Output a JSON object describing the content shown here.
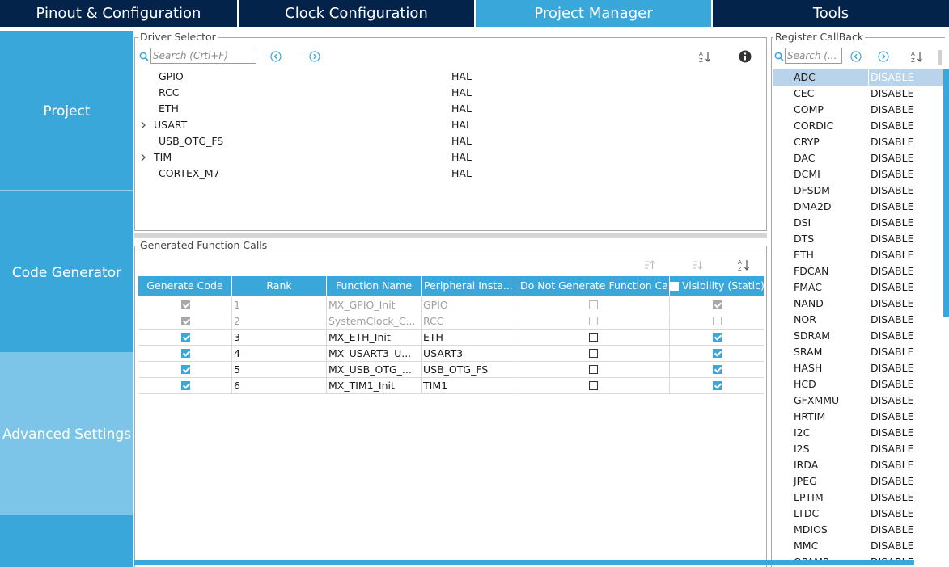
{
  "tabs": [
    {
      "label": "Pinout & Configuration"
    },
    {
      "label": "Clock Configuration"
    },
    {
      "label": "Project Manager"
    },
    {
      "label": "Tools"
    }
  ],
  "nav": {
    "project": "Project",
    "code_generator": "Code Generator",
    "advanced_settings": "Advanced Settings"
  },
  "driver_selector": {
    "title": "Driver Selector",
    "search_placeholder": "Search (Crtl+F)",
    "items": [
      {
        "name": "GPIO",
        "driver": "HAL",
        "expandable": false
      },
      {
        "name": "RCC",
        "driver": "HAL",
        "expandable": false
      },
      {
        "name": "ETH",
        "driver": "HAL",
        "expandable": false
      },
      {
        "name": "USART",
        "driver": "HAL",
        "expandable": true
      },
      {
        "name": "USB_OTG_FS",
        "driver": "HAL",
        "expandable": false
      },
      {
        "name": "TIM",
        "driver": "HAL",
        "expandable": true
      },
      {
        "name": "CORTEX_M7",
        "driver": "HAL",
        "expandable": false
      }
    ]
  },
  "generated_calls": {
    "title": "Generated Function Calls",
    "columns": [
      "Generate Code",
      "Rank",
      "Function Name",
      "Peripheral Insta...",
      "Do Not Generate Function Ca",
      "Visibility (Static)"
    ],
    "rows": [
      {
        "generate": true,
        "disabled": true,
        "rank": "1",
        "function": "MX_GPIO_Init",
        "peripheral": "GPIO",
        "no_call": false,
        "visibility": true
      },
      {
        "generate": true,
        "disabled": true,
        "rank": "2",
        "function": "SystemClock_C...",
        "peripheral": "RCC",
        "no_call": false,
        "visibility": false
      },
      {
        "generate": true,
        "disabled": false,
        "rank": "3",
        "function": "MX_ETH_Init",
        "peripheral": "ETH",
        "no_call": false,
        "visibility": true
      },
      {
        "generate": true,
        "disabled": false,
        "rank": "4",
        "function": "MX_USART3_U...",
        "peripheral": "USART3",
        "no_call": false,
        "visibility": true
      },
      {
        "generate": true,
        "disabled": false,
        "rank": "5",
        "function": "MX_USB_OTG_...",
        "peripheral": "USB_OTG_FS",
        "no_call": false,
        "visibility": true
      },
      {
        "generate": true,
        "disabled": false,
        "rank": "6",
        "function": "MX_TIM1_Init",
        "peripheral": "TIM1",
        "no_call": false,
        "visibility": true
      }
    ]
  },
  "register_callback": {
    "title": "Register CallBack",
    "search_placeholder": "Search (...",
    "items": [
      {
        "name": "ADC",
        "value": "DISABLE"
      },
      {
        "name": "CEC",
        "value": "DISABLE"
      },
      {
        "name": "COMP",
        "value": "DISABLE"
      },
      {
        "name": "CORDIC",
        "value": "DISABLE"
      },
      {
        "name": "CRYP",
        "value": "DISABLE"
      },
      {
        "name": "DAC",
        "value": "DISABLE"
      },
      {
        "name": "DCMI",
        "value": "DISABLE"
      },
      {
        "name": "DFSDM",
        "value": "DISABLE"
      },
      {
        "name": "DMA2D",
        "value": "DISABLE"
      },
      {
        "name": "DSI",
        "value": "DISABLE"
      },
      {
        "name": "DTS",
        "value": "DISABLE"
      },
      {
        "name": "ETH",
        "value": "DISABLE"
      },
      {
        "name": "FDCAN",
        "value": "DISABLE"
      },
      {
        "name": "FMAC",
        "value": "DISABLE"
      },
      {
        "name": "NAND",
        "value": "DISABLE"
      },
      {
        "name": "NOR",
        "value": "DISABLE"
      },
      {
        "name": "SDRAM",
        "value": "DISABLE"
      },
      {
        "name": "SRAM",
        "value": "DISABLE"
      },
      {
        "name": "HASH",
        "value": "DISABLE"
      },
      {
        "name": "HCD",
        "value": "DISABLE"
      },
      {
        "name": "GFXMMU",
        "value": "DISABLE"
      },
      {
        "name": "HRTIM",
        "value": "DISABLE"
      },
      {
        "name": "I2C",
        "value": "DISABLE"
      },
      {
        "name": "I2S",
        "value": "DISABLE"
      },
      {
        "name": "IRDA",
        "value": "DISABLE"
      },
      {
        "name": "JPEG",
        "value": "DISABLE"
      },
      {
        "name": "LPTIM",
        "value": "DISABLE"
      },
      {
        "name": "LTDC",
        "value": "DISABLE"
      },
      {
        "name": "MDIOS",
        "value": "DISABLE"
      },
      {
        "name": "MMC",
        "value": "DISABLE"
      },
      {
        "name": "OPAMP",
        "value": "DISABLE"
      }
    ]
  },
  "icons": [
    "search-icon",
    "prev-icon",
    "next-icon",
    "sort-az-icon",
    "info-icon",
    "sort-up-icon",
    "sort-down-icon",
    "expand-chevron-icon"
  ],
  "colors": {
    "tab_dark": "#03234b",
    "accent": "#3aa7db",
    "nav_active": "#7cc5e8"
  }
}
